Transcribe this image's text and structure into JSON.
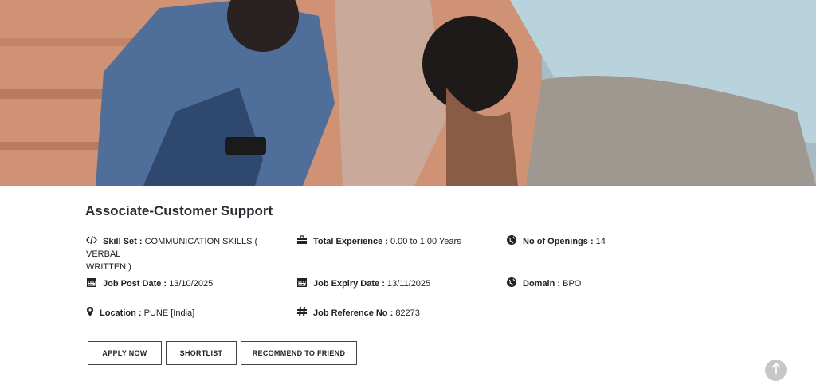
{
  "job": {
    "title": "Associate-Customer Support",
    "skill_set_label": "Skill Set :",
    "skill_set_value": "COMMUNICATION SKILLS ( VERBAL ,",
    "skill_set_value_2": "WRITTEN )",
    "experience_label": "Total Experience :",
    "experience_value": "0.00 to 1.00 Years",
    "openings_label": "No of Openings :",
    "openings_value": "14",
    "post_date_label": "Job Post Date :",
    "post_date_value": "13/10/2025",
    "expiry_date_label": "Job Expiry Date :",
    "expiry_date_value": "13/11/2025",
    "domain_label": "Domain :",
    "domain_value": "BPO",
    "location_label": "Location :",
    "location_value": "PUNE [India]",
    "reference_label": "Job Reference No :",
    "reference_value": "82273"
  },
  "actions": {
    "apply": "APPLY NOW",
    "shortlist": "SHORTLIST",
    "recommend": "RECOMMEND TO FRIEND"
  },
  "icons": {
    "skill": "code-icon",
    "experience": "briefcase-icon",
    "openings": "globe-icon",
    "post_date": "calendar-icon",
    "expiry_date": "calendar-icon",
    "domain": "globe-icon",
    "location": "map-pin-icon",
    "reference": "hash-icon",
    "scroll_top": "arrow-up-icon"
  }
}
